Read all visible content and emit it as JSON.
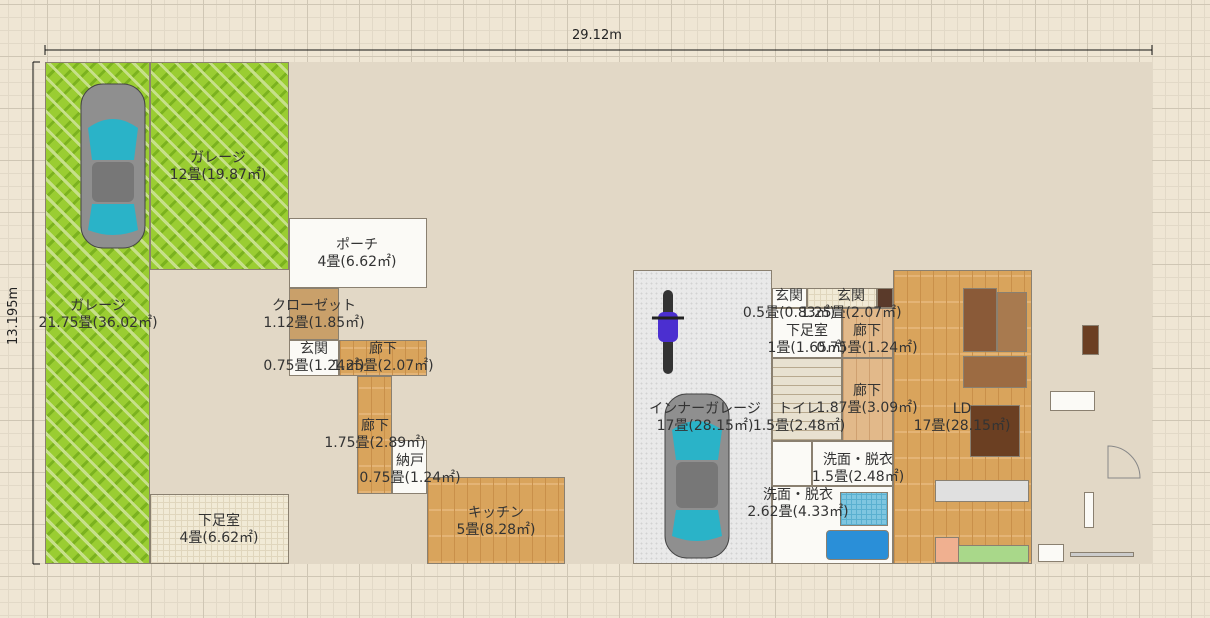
{
  "dimensions": {
    "width_label": "29.12m",
    "height_label": "13.195m"
  },
  "rooms": [
    {
      "name": "ガレージ",
      "area": "12畳(19.87㎡)"
    },
    {
      "name": "ガレージ",
      "area": "21.75畳(36.02㎡)"
    },
    {
      "name": "ポーチ",
      "area": "4畳(6.62㎡)"
    },
    {
      "name": "クローゼット",
      "area": "1.12畳(1.85㎡)"
    },
    {
      "name": "玄関",
      "area": "0.75畳(1.24㎡)"
    },
    {
      "name": "廊下",
      "area": "1.25畳(2.07㎡)"
    },
    {
      "name": "廊下",
      "area": "1.75畳(2.89㎡)"
    },
    {
      "name": "納戸",
      "area": "0.75畳(1.24㎡)"
    },
    {
      "name": "キッチン",
      "area": "5畳(8.28㎡)"
    },
    {
      "name": "下足室",
      "area": "4畳(6.62㎡)"
    },
    {
      "name": "インナーガレージ",
      "area": "17畳(28.15㎡)"
    },
    {
      "name": "玄関",
      "area": "0.5畳(0.83㎡)"
    },
    {
      "name": "玄関",
      "area": "1.25畳(2.07㎡)"
    },
    {
      "name": "下足室",
      "area": "1畳(1.65㎡)"
    },
    {
      "name": "廊下",
      "area": "0.75畳(1.24㎡)"
    },
    {
      "name": "廊下",
      "area": "1.87畳(3.09㎡)"
    },
    {
      "name": "トイレ",
      "area": "1.5畳(2.48㎡)"
    },
    {
      "name": "洗面・脱衣",
      "area": "1.5畳(2.48㎡)"
    },
    {
      "name": "洗面・脱衣",
      "area": "2.62畳(4.33㎡)"
    },
    {
      "name": "LD",
      "area": "17畳(28.15㎡)"
    }
  ],
  "colors": {
    "grass": "#9acd32",
    "wood": "#d9a45c",
    "tile": "#f1ead6",
    "grid_bg": "#efe6d4"
  }
}
